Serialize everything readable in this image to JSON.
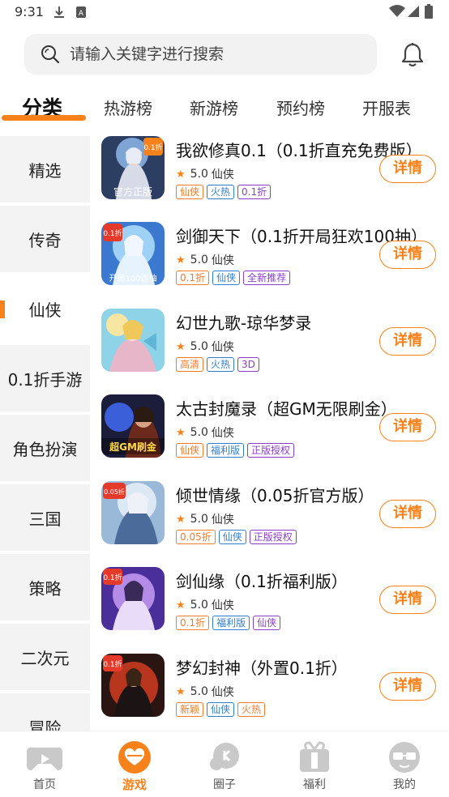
{
  "status_bar": {
    "time": "9:31"
  },
  "search": {
    "placeholder": "请输入关键字进行搜索"
  },
  "tabs": [
    {
      "label": "分类",
      "active": true
    },
    {
      "label": "热游榜"
    },
    {
      "label": "新游榜"
    },
    {
      "label": "预约榜"
    },
    {
      "label": "开服表"
    }
  ],
  "categories": [
    {
      "label": "精选"
    },
    {
      "label": "传奇"
    },
    {
      "label": "仙侠",
      "active": true
    },
    {
      "label": "0.1折手游"
    },
    {
      "label": "角色扮演"
    },
    {
      "label": "三国"
    },
    {
      "label": "策略"
    },
    {
      "label": "二次元"
    },
    {
      "label": "冒险"
    }
  ],
  "games": [
    {
      "name": "我欲修真0.1（0.1折直充免费版）",
      "rating": "5.0",
      "genre": "仙侠",
      "tags": [
        "仙侠",
        "火热",
        "0.1折"
      ],
      "button": "详情",
      "thumb_badge": "0.1折",
      "thumb_caption": "官方正版"
    },
    {
      "name": "剑御天下（0.1折开局狂欢100抽）",
      "rating": "5.0",
      "genre": "仙侠",
      "tags": [
        "0.1折",
        "仙侠",
        "全新推荐"
      ],
      "button": "详情",
      "thumb_badge": "0.1折",
      "thumb_caption": "开局100连抽"
    },
    {
      "name": "幻世九歌-琼华梦录",
      "rating": "5.0",
      "genre": "仙侠",
      "tags": [
        "高清",
        "火热",
        "3D"
      ],
      "button": "详情",
      "thumb_badge": "",
      "thumb_caption": ""
    },
    {
      "name": "太古封魔录（超GM无限刷金）",
      "rating": "5.0",
      "genre": "仙侠",
      "tags": [
        "仙侠",
        "福利版",
        "正版授权"
      ],
      "button": "详情",
      "thumb_badge": "",
      "thumb_caption": "超GM刷金"
    },
    {
      "name": "倾世情缘（0.05折官方版）",
      "rating": "5.0",
      "genre": "仙侠",
      "tags": [
        "0.05折",
        "仙侠",
        "正版授权"
      ],
      "button": "详情",
      "thumb_badge": "0.05折",
      "thumb_caption": ""
    },
    {
      "name": "剑仙缘（0.1折福利版）",
      "rating": "5.0",
      "genre": "仙侠",
      "tags": [
        "0.1折",
        "福利版",
        "仙侠"
      ],
      "button": "详情",
      "thumb_badge": "0.1折",
      "thumb_caption": ""
    },
    {
      "name": "梦幻封神（外置0.1折）",
      "rating": "5.0",
      "genre": "仙侠",
      "tags": [
        "新颖",
        "仙侠",
        "火热"
      ],
      "button": "详情",
      "thumb_badge": "0.1折",
      "thumb_caption": ""
    }
  ],
  "bottom_nav": [
    {
      "label": "首页",
      "icon": "gamepad-icon"
    },
    {
      "label": "游戏",
      "icon": "game-heart-icon",
      "active": true
    },
    {
      "label": "圈子",
      "icon": "chat-bubble-icon"
    },
    {
      "label": "福利",
      "icon": "gift-icon"
    },
    {
      "label": "我的",
      "icon": "profile-face-icon"
    }
  ],
  "colors": {
    "accent": "#f7821b",
    "tag_orange": "#f27c2a",
    "tag_blue": "#2f7fd1",
    "tag_purple": "#8a3fc9"
  }
}
